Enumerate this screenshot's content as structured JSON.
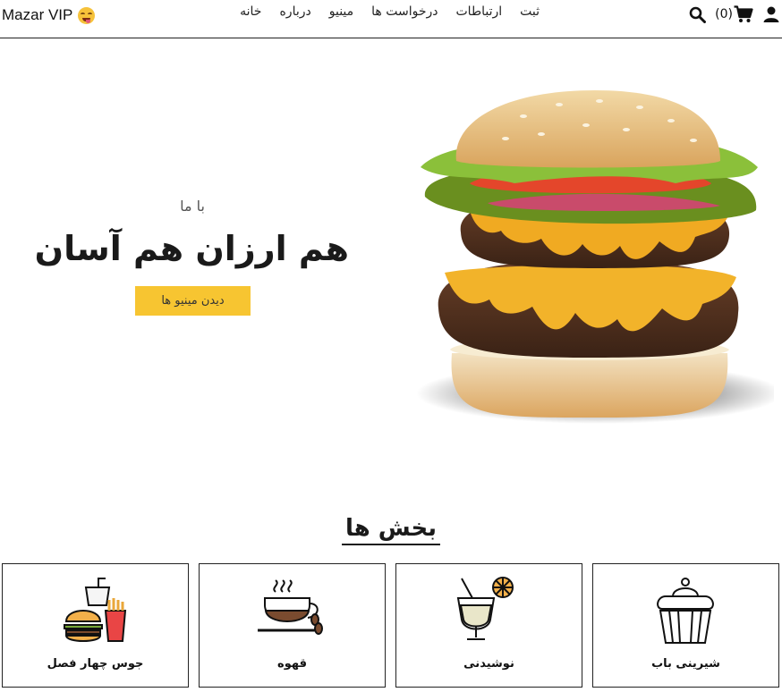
{
  "brand": {
    "name": "Mazar VIP",
    "emoji": "face-savoring-food-emoji"
  },
  "nav": {
    "links": [
      "خانه",
      "درباره",
      "مینیو",
      "درخواست ها",
      "ارتباطات",
      "ثبت"
    ],
    "cart_count": "(0)"
  },
  "hero": {
    "subtitle": "با ما",
    "title": "هم ارزان هم آسان",
    "button": "دیدن مینیو ها",
    "accent_color": "#f7c531"
  },
  "sections": {
    "title": "بخش ها",
    "cards": [
      {
        "label": "جوس چهار فصل",
        "icon": "fast-food-icon"
      },
      {
        "label": "قهوه",
        "icon": "coffee-cup-icon"
      },
      {
        "label": "نوشیدنی",
        "icon": "drink-glass-icon"
      },
      {
        "label": "شیرینی باب",
        "icon": "cupcake-icon"
      }
    ]
  }
}
